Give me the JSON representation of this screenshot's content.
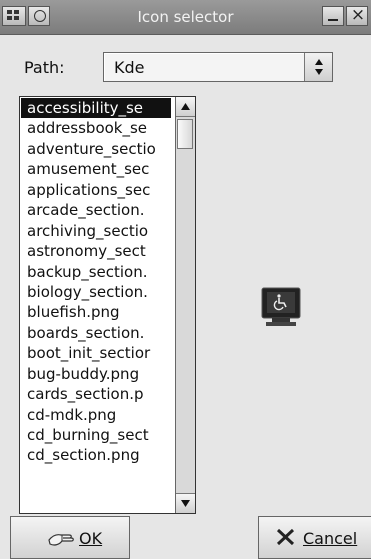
{
  "window": {
    "title": "Icon selector"
  },
  "path": {
    "label": "Path:",
    "value": "Kde"
  },
  "list": {
    "items": [
      "accessibility_se",
      "addressbook_se",
      "adventure_sectio",
      "amusement_sec",
      "applications_sec",
      "arcade_section.",
      "archiving_sectio",
      "astronomy_sect",
      "backup_section.",
      "biology_section.",
      "bluefish.png",
      "boards_section.",
      "boot_init_sectior",
      "bug-buddy.png",
      "cards_section.p",
      "cd-mdk.png",
      "cd_burning_sect",
      "cd_section.png"
    ],
    "selected_index": 0
  },
  "buttons": {
    "ok_label": "OK",
    "cancel_label": "Cancel"
  }
}
